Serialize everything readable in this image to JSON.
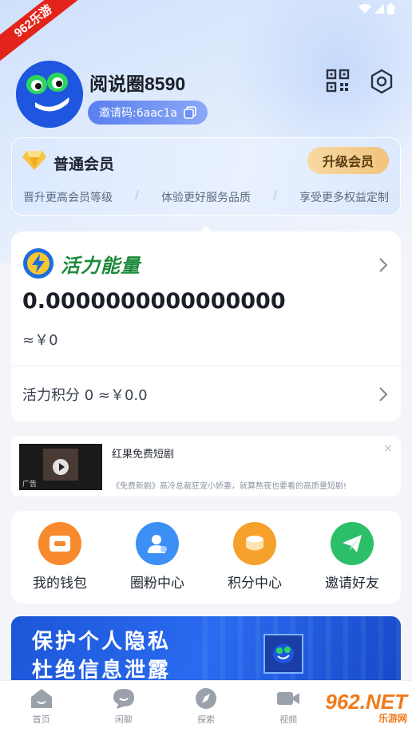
{
  "watermark": "962乐游",
  "profile": {
    "username": "阅说圈8590",
    "invite_label": "邀请码:6aac1a"
  },
  "member": {
    "title": "普通会员",
    "upgrade_label": "升级会员",
    "perks": [
      "晋升更高会员等级",
      "体验更好服务品质",
      "享受更多权益定制"
    ],
    "separator": "/"
  },
  "energy": {
    "title": "活力能量",
    "value": "0.0000000000000000",
    "cny": "≈￥0",
    "points_label": "活力积分 0 ≈￥0.0"
  },
  "ad": {
    "title": "红果免费短剧",
    "tag": "广告",
    "description": "《免费新剧》高冷总裁狂宠小娇妻，就算熬夜也要看的高质量短剧!",
    "close": "×"
  },
  "features": [
    {
      "label": "我的钱包",
      "icon": "wallet-icon",
      "color": "#f68a2c"
    },
    {
      "label": "圈粉中心",
      "icon": "user-heart-icon",
      "color": "#3b8ff5"
    },
    {
      "label": "积分中心",
      "icon": "points-icon",
      "color": "#f6a12c"
    },
    {
      "label": "邀请好友",
      "icon": "paper-plane-icon",
      "color": "#2cbf6a"
    }
  ],
  "banner": {
    "line1": "保护个人隐私",
    "line2": "杜绝信息泄露"
  },
  "tabs": [
    {
      "label": "首页",
      "icon": "home-icon"
    },
    {
      "label": "闲聊",
      "icon": "chat-icon"
    },
    {
      "label": "探索",
      "icon": "compass-icon"
    },
    {
      "label": "视频",
      "icon": "video-icon"
    }
  ],
  "site_watermark": {
    "main": "962.NET",
    "sub": "乐游网"
  }
}
